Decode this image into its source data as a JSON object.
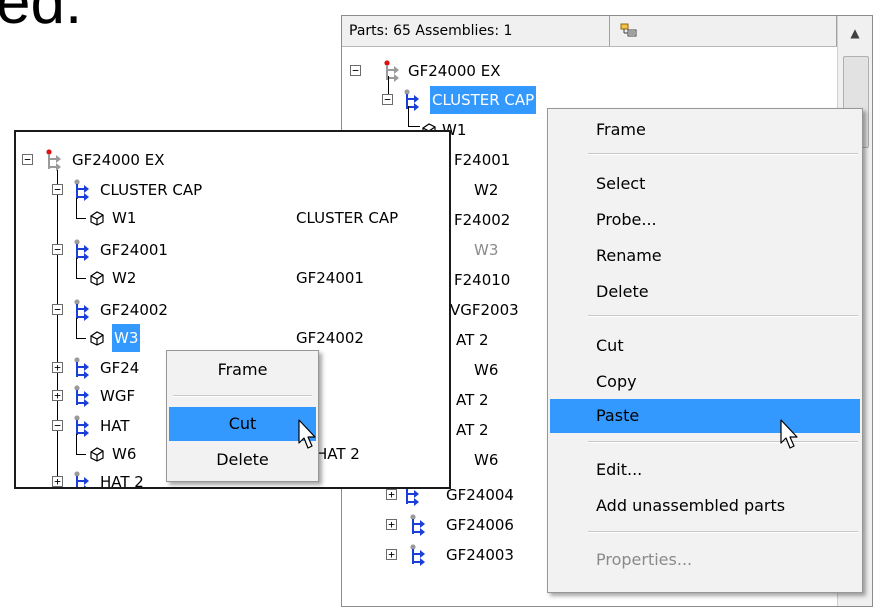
{
  "heading_fragment": "ed.",
  "right_panel": {
    "status": {
      "parts_label": "Parts: 65   Assemblies: 1"
    },
    "nodes": [
      {
        "label": "GF24000 EX"
      },
      {
        "label": "CLUSTER CAP"
      },
      {
        "label": "W1"
      },
      {
        "label": "F24001"
      },
      {
        "label": "W2"
      },
      {
        "label": "F24002"
      },
      {
        "label": "W3"
      },
      {
        "label": "F24010"
      },
      {
        "label": "VGF2003"
      },
      {
        "label": "AT 2"
      },
      {
        "label": "W6"
      },
      {
        "label": "AT 2"
      },
      {
        "label": "AT 2"
      },
      {
        "label": "W6"
      },
      {
        "label": "GF24004"
      },
      {
        "label": "GF24006"
      },
      {
        "label": "GF24003"
      }
    ],
    "context_menu": {
      "items": [
        {
          "label": "Frame"
        },
        {
          "label": "Select"
        },
        {
          "label": "Probe..."
        },
        {
          "label": "Rename"
        },
        {
          "label": "Delete"
        },
        {
          "label": "Cut"
        },
        {
          "label": "Copy"
        },
        {
          "label": "Paste"
        },
        {
          "label": "Edit..."
        },
        {
          "label": "Add unassembled parts"
        },
        {
          "label": "Properties..."
        }
      ]
    }
  },
  "left_panel": {
    "nodes": [
      {
        "label": "GF24000 EX"
      },
      {
        "label": "CLUSTER CAP"
      },
      {
        "label": "W1",
        "desc": "CLUSTER CAP"
      },
      {
        "label": "GF24001"
      },
      {
        "label": "W2",
        "desc": "GF24001"
      },
      {
        "label": "GF24002"
      },
      {
        "label": "W3",
        "desc": "GF24002"
      },
      {
        "label": "GF24"
      },
      {
        "label": "WGF"
      },
      {
        "label": "HAT"
      },
      {
        "label": "W6",
        "desc": "HAT 2"
      },
      {
        "label": "HAT 2"
      }
    ],
    "context_menu": {
      "items": [
        {
          "label": "Frame"
        },
        {
          "label": "Cut"
        },
        {
          "label": "Delete"
        }
      ]
    }
  },
  "colors": {
    "selection": "#3399ff",
    "menu_bg": "#f2f2f2",
    "assembly_blue": "#1a3fd9",
    "root_red": "#e01010"
  }
}
